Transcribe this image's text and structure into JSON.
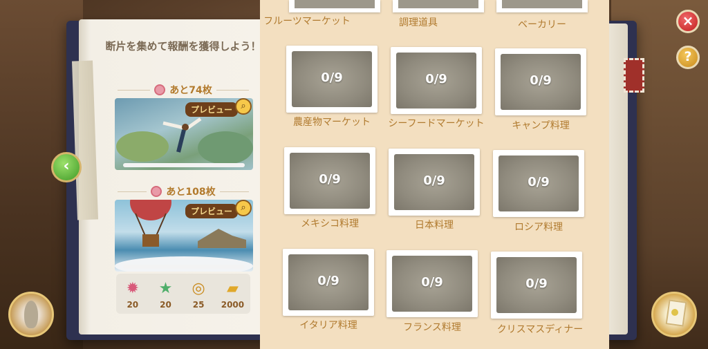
{
  "left_page": {
    "intro": "断片を集めて報酬を獲得しよう！",
    "rewards": [
      {
        "remaining": "あと74枚",
        "preview_label": "プレビュー",
        "progress_fraction": 0.0
      },
      {
        "remaining": "あと108枚",
        "preview_label": "プレビュー",
        "progress_fraction": 0.0
      }
    ],
    "items": [
      {
        "icon": "pink-badge-icon",
        "value": "20"
      },
      {
        "icon": "green-star-icon",
        "value": "20"
      },
      {
        "icon": "compass-icon",
        "value": "25"
      },
      {
        "icon": "gold-bars-icon",
        "value": "2000"
      }
    ]
  },
  "right_page": {
    "top_row_labels": [
      "フルーツマーケット",
      "調理道具",
      "ベーカリー"
    ],
    "tiles": [
      {
        "count": "0/9",
        "label": "農産物マーケット"
      },
      {
        "count": "0/9",
        "label": "シーフードマーケット"
      },
      {
        "count": "0/9",
        "label": "キャンプ料理"
      },
      {
        "count": "0/9",
        "label": "メキシコ料理"
      },
      {
        "count": "0/9",
        "label": "日本料理"
      },
      {
        "count": "0/9",
        "label": "ロシア料理"
      },
      {
        "count": "0/9",
        "label": "イタリア料理"
      },
      {
        "count": "0/9",
        "label": "フランス料理"
      },
      {
        "count": "0/9",
        "label": "クリスマスディナー"
      }
    ]
  },
  "buttons": {
    "back": "‹",
    "close": "×",
    "help": "?"
  },
  "colors": {
    "accent_gold": "#b07a2e",
    "close_red": "#c21d1d",
    "back_green": "#3f9a27"
  }
}
